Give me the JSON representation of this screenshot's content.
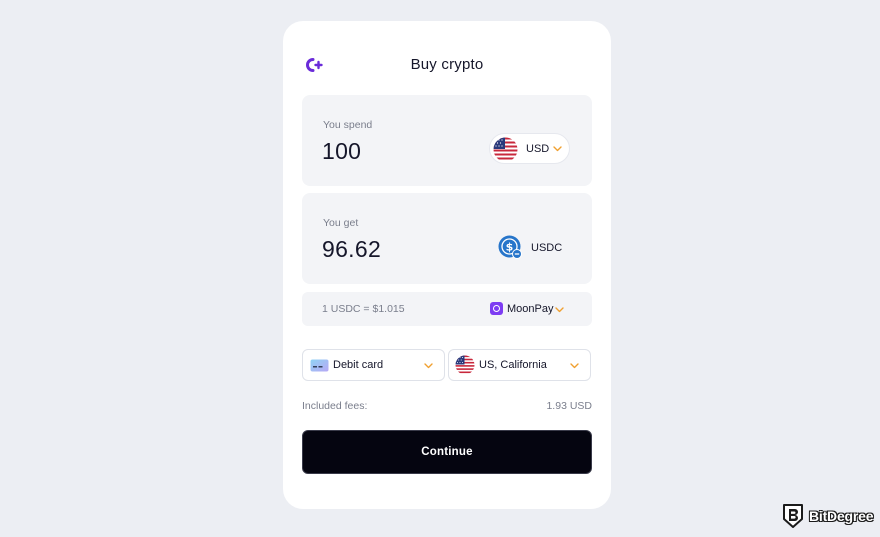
{
  "widget": {
    "title": "Buy crypto",
    "logo_icon": "c-plus-logo-icon"
  },
  "spend": {
    "label": "You spend",
    "amount": "100",
    "currency": "USD",
    "currency_icon": "us-flag-icon"
  },
  "get": {
    "label": "You get",
    "amount": "96.62",
    "currency": "USDC",
    "currency_icon": "usdc-coin-icon"
  },
  "rate": {
    "text": "1 USDC = $1.015",
    "provider": "MoonPay",
    "provider_icon": "moonpay-icon"
  },
  "payment_method": {
    "value": "Debit card",
    "icon": "credit-card-icon"
  },
  "region": {
    "value": "US, California",
    "icon": "us-flag-icon"
  },
  "fees": {
    "label": "Included fees:",
    "value": "1.93 USD"
  },
  "continue_label": "Continue",
  "watermark": {
    "brand": "BitDegree"
  },
  "colors": {
    "background": "#eceef3",
    "card": "#ffffff",
    "panel": "#f3f4f7",
    "accent": "#6a2bd9",
    "chevron": "#f0a030",
    "button": "#050510",
    "usdc_blue": "#2775ca"
  }
}
